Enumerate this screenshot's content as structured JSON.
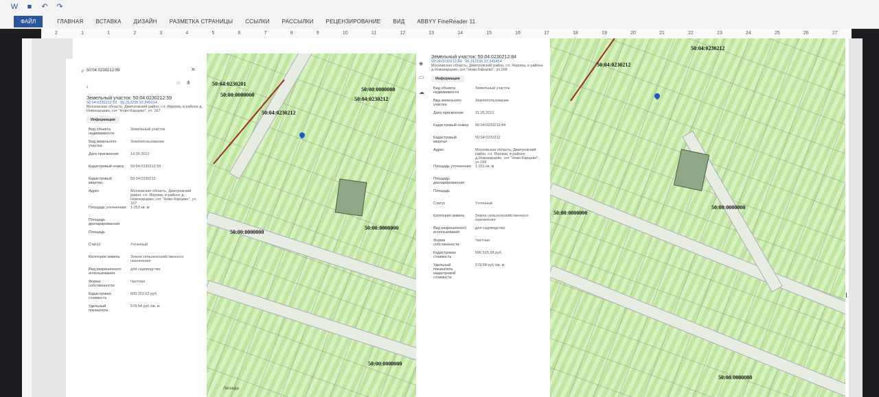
{
  "word": {
    "app_title": "ABBYY FineReader 11",
    "tabs": [
      "ФАЙЛ",
      "ГЛАВНАЯ",
      "ВСТАВКА",
      "ДИЗАЙН",
      "РАЗМЕТКА СТРАНИЦЫ",
      "ССЫЛКИ",
      "РАССЫЛКИ",
      "РЕЦЕНЗИРОВАНИЕ",
      "ВИД"
    ],
    "ruler": [
      "2",
      "1",
      "1",
      "2",
      "3",
      "4",
      "5",
      "6",
      "7",
      "8",
      "9",
      "10",
      "11",
      "12",
      "13",
      "14",
      "15",
      "16",
      "17",
      "18",
      "19",
      "20",
      "21",
      "22",
      "23",
      "24",
      "25",
      "26",
      "27"
    ]
  },
  "panel_left": {
    "search": "50:04:0230212:59",
    "heading": "Земельный участок: 50:04:0230212:59",
    "numbers": "50:04:0230212:59 · 56.312235 37.345014",
    "address_line": "Московская область, Дмитровский район, г.п. Яхрома, в районе д. Новокарцево, снт \"Ново-Карцево\", уч. 167",
    "info_tab": "Информация",
    "rows": [
      [
        "Вид объекта недвижимости",
        "Земельный участок"
      ],
      [
        "Вид земельного участка",
        "Землепользование"
      ],
      [
        "Дата присвоения",
        "14.05.2012"
      ],
      [
        "Кадастровый номер",
        "50:04:0230212:59"
      ],
      [
        "Кадастровый квартал",
        "50:04:0230212"
      ],
      [
        "Адрес",
        "Московская область, Дмитровский район, г.п. Яхрома, в районе д. Новокарцево, снт \"Ново-Карцево\", уч. 167"
      ],
      [
        "Площадь уточненная",
        "1 053 кв. м"
      ],
      [
        "Площадь декларированная",
        ""
      ],
      [
        "Площадь",
        ""
      ],
      [
        "Статус",
        "Учтенный"
      ],
      [
        "Категория земель",
        "Земли сельскохозяйственного назначения"
      ],
      [
        "Вид разрешенного использования",
        "для садоводства"
      ],
      [
        "Форма собственности",
        "Частная"
      ],
      [
        "Кадастровая стоимость",
        "609 202,62 руб."
      ],
      [
        "Удельный показатель",
        "578,54 руб./кв. м"
      ]
    ],
    "legend": "Легенда"
  },
  "panel_right": {
    "heading": "Земельный участок: 50:04:0230212:84",
    "numbers": "50:04:0230212:84 · 56.312156 37.345454",
    "address_line": "Московская область, Дмитровский район, г.п. Яхрома, в районе д.Новокарцево, снт \"Ново-Карцево\", уч.168",
    "info_tab": "Информация",
    "rows": [
      [
        "Вид объекта недвижимости",
        "Земельный участок"
      ],
      [
        "Вид земельного участка",
        "Землепользование"
      ],
      [
        "Дата присвоения",
        "31.05.2012"
      ],
      [
        "Кадастровый номер",
        "50:04:0230212:84"
      ],
      [
        "Кадастровый квартал",
        "50:04:0230212"
      ],
      [
        "Адрес",
        "Московская область, Дмитровский район, г.п. Яхрома, в районе д.Новокарцево, снт \"Ново-Карцево\", уч.168"
      ],
      [
        "Площадь уточненная",
        "1 031 кв. м"
      ],
      [
        "Площадь декларированная",
        ""
      ],
      [
        "Площадь",
        ""
      ],
      [
        "Статус",
        "Учтенный"
      ],
      [
        "Категория земель",
        "Земли сельскохозяйственного назначения"
      ],
      [
        "Вид разрешенного использования",
        "для садоводства"
      ],
      [
        "Форма собственности",
        "Частная"
      ],
      [
        "Кадастровая стоимость",
        "596 515,98 руб."
      ],
      [
        "Удельный показатель кадастровой стоимости",
        "578,58 руб./кв. м"
      ]
    ]
  },
  "map_left_labels": [
    "50:04:0230201",
    "50:00:0000000",
    "50:04:0230212",
    "50:00:0000000",
    "50:04:0230212",
    "50:00:0000000",
    "50:00:0000000",
    "50:00:0000000"
  ],
  "map_right_labels": [
    "50:04:0230212",
    "50:04:0230212",
    "50:00:0000000",
    "50:00:0000000",
    "50:00:0000000"
  ],
  "colors": {
    "ribbon_blue": "#2b579a",
    "map_green": "#c4eaa6",
    "plot": "#8fa885",
    "pin": "#1e58c6",
    "red_line": "#9b2d1f"
  }
}
